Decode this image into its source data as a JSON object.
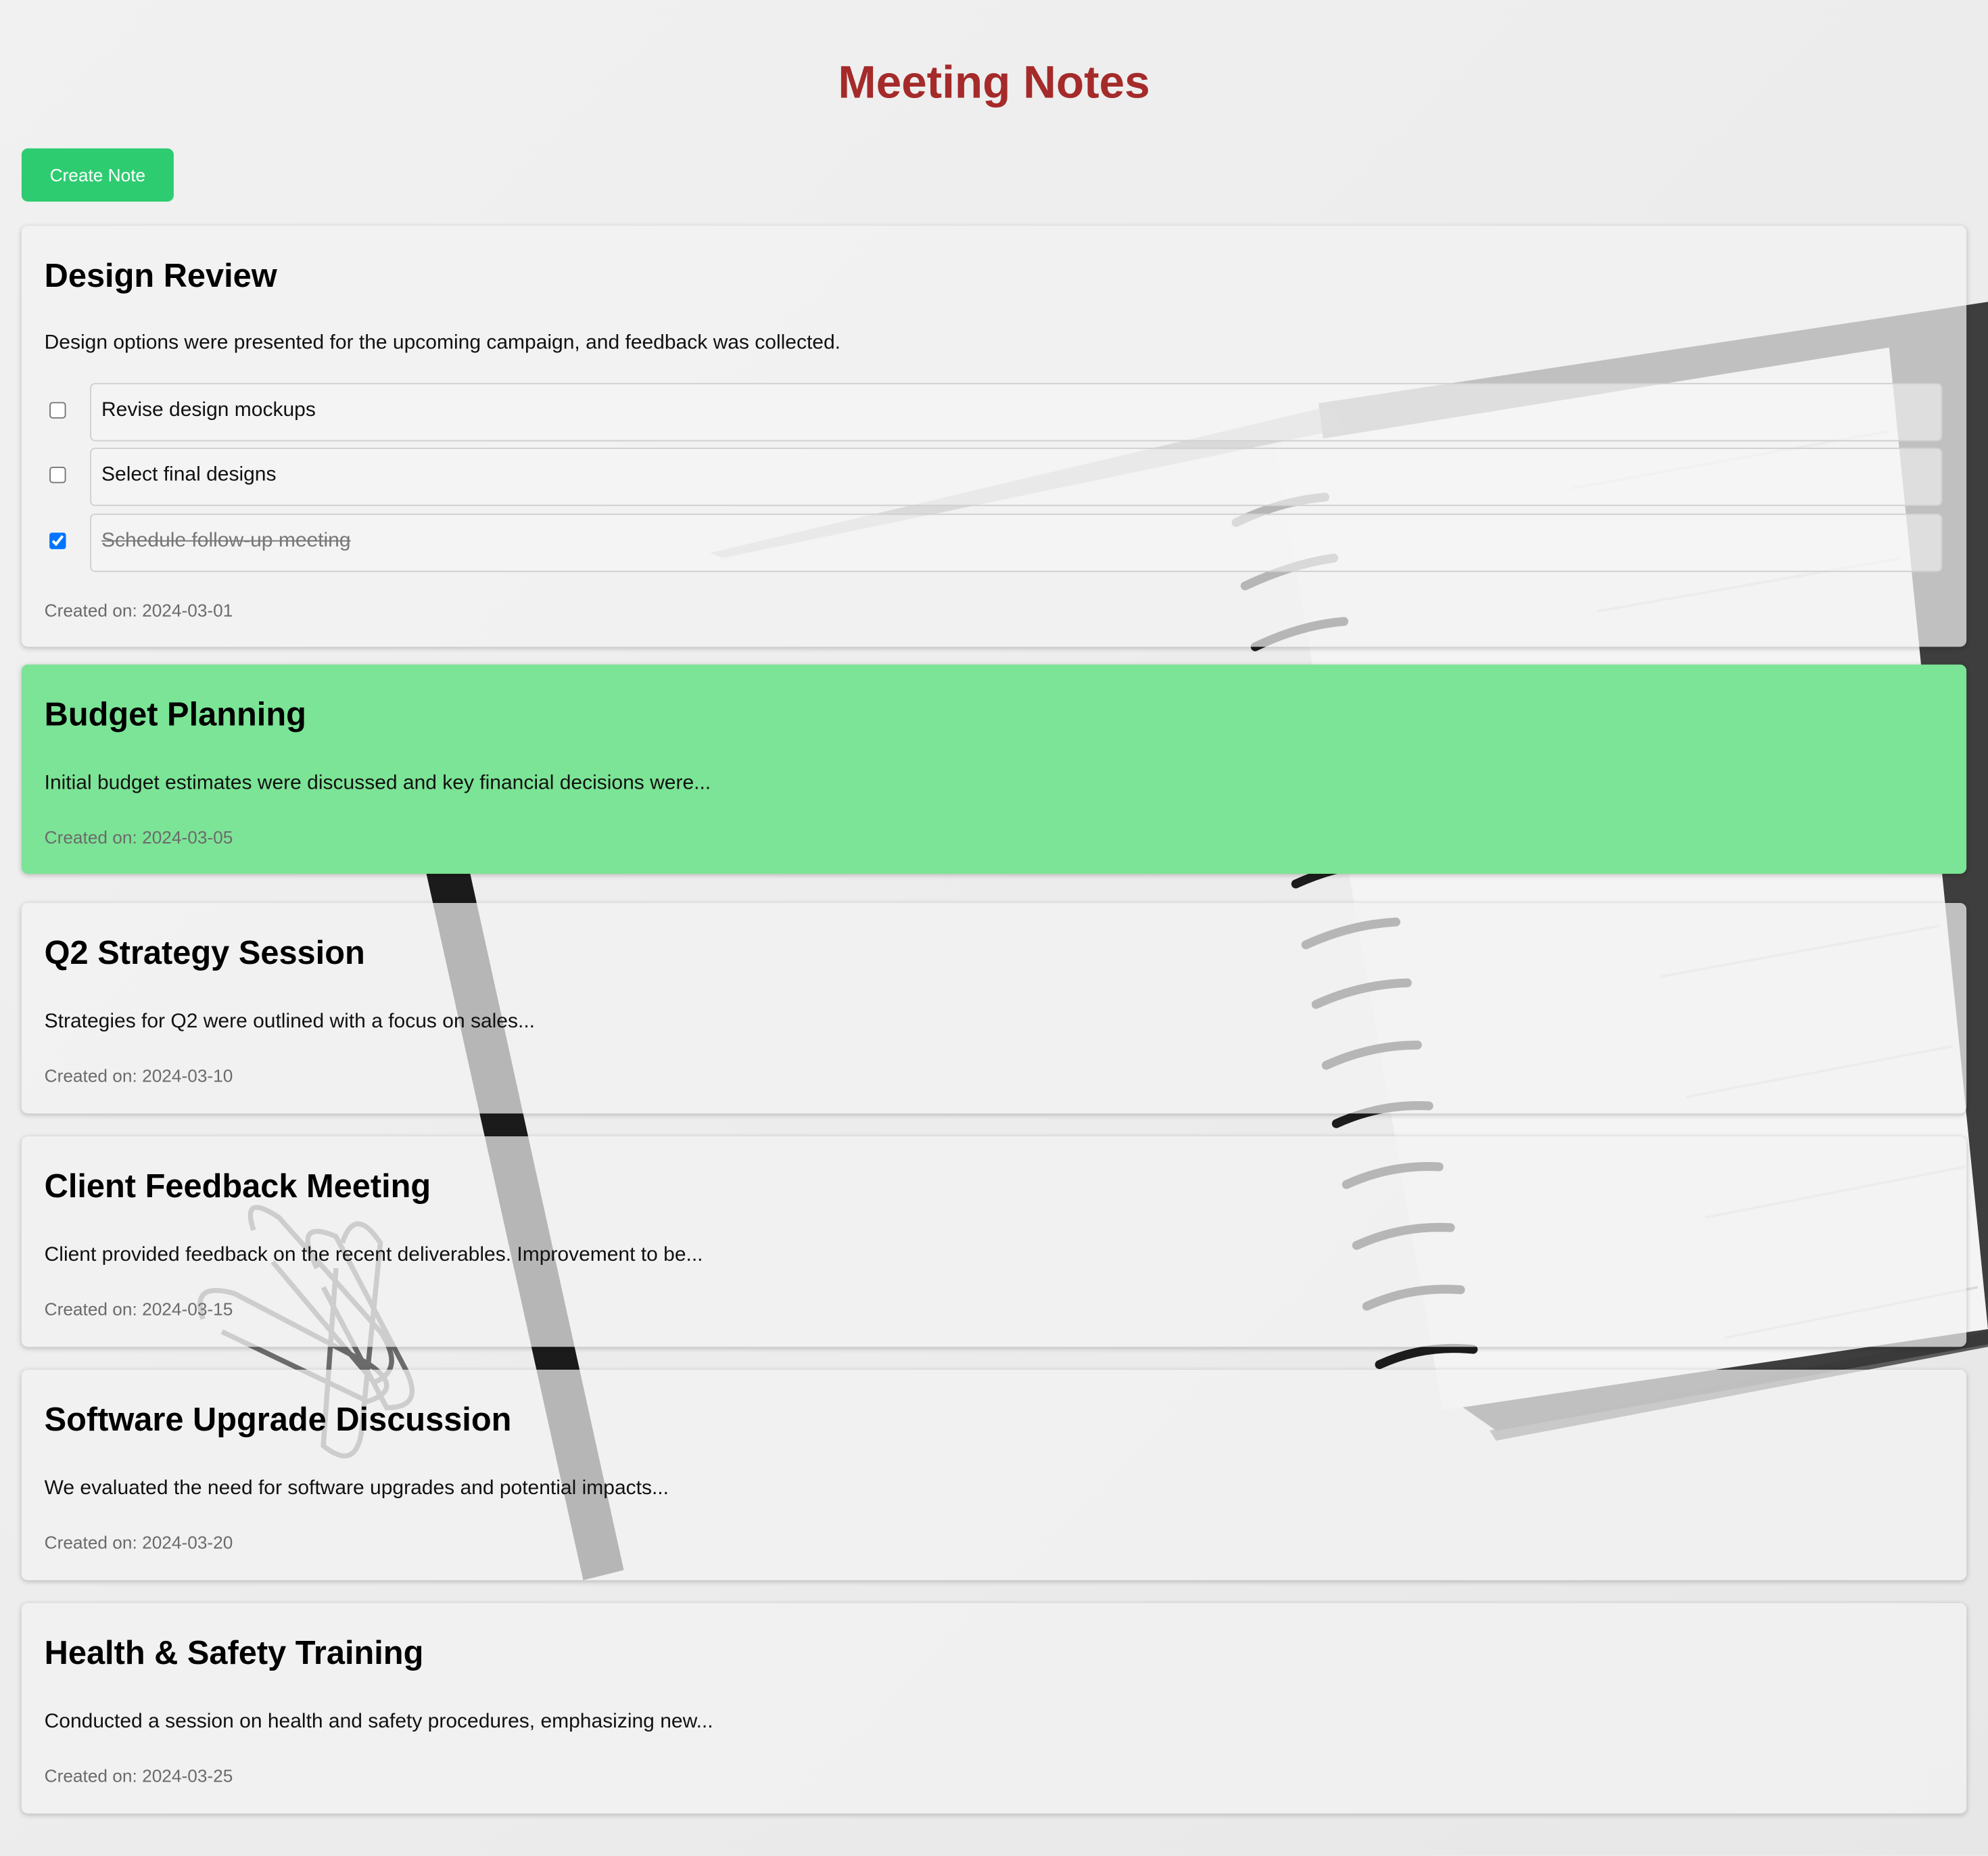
{
  "header": {
    "title": "Meeting Notes",
    "create_button_label": "Create Note"
  },
  "notes": [
    {
      "title": "Design Review",
      "summary": "Design options were presented for the upcoming campaign, and feedback was collected.",
      "tasks": [
        {
          "label": "Revise design mockups",
          "done": false
        },
        {
          "label": "Select final designs",
          "done": false
        },
        {
          "label": "Schedule follow-up meeting",
          "done": true
        }
      ],
      "created": "Created on: 2024-03-01"
    },
    {
      "title": "Budget Planning",
      "summary": "Initial budget estimates were discussed and key financial decisions were...",
      "created": "Created on: 2024-03-05",
      "highlighted": true
    },
    {
      "title": "Q2 Strategy Session",
      "summary": "Strategies for Q2 were outlined with a focus on sales...",
      "created": "Created on: 2024-03-10"
    },
    {
      "title": "Client Feedback Meeting",
      "summary": "Client provided feedback on the recent deliverables. Improvement to be...",
      "created": "Created on: 2024-03-15"
    },
    {
      "title": "Software Upgrade Discussion",
      "summary": "We evaluated the need for software upgrades and potential impacts...",
      "created": "Created on: 2024-03-20"
    },
    {
      "title": "Health & Safety Training",
      "summary": "Conducted a session on health and safety procedures, emphasizing new...",
      "created": "Created on: 2024-03-25"
    }
  ],
  "colors": {
    "title": "#a52a2a",
    "create_button": "#2ecc71",
    "highlight": "#7ce496",
    "meta_text": "#6b6b6b"
  },
  "icons": {
    "checkbox_unchecked": "checkbox-unchecked-icon",
    "checkbox_checked": "checkbox-checked-icon"
  }
}
